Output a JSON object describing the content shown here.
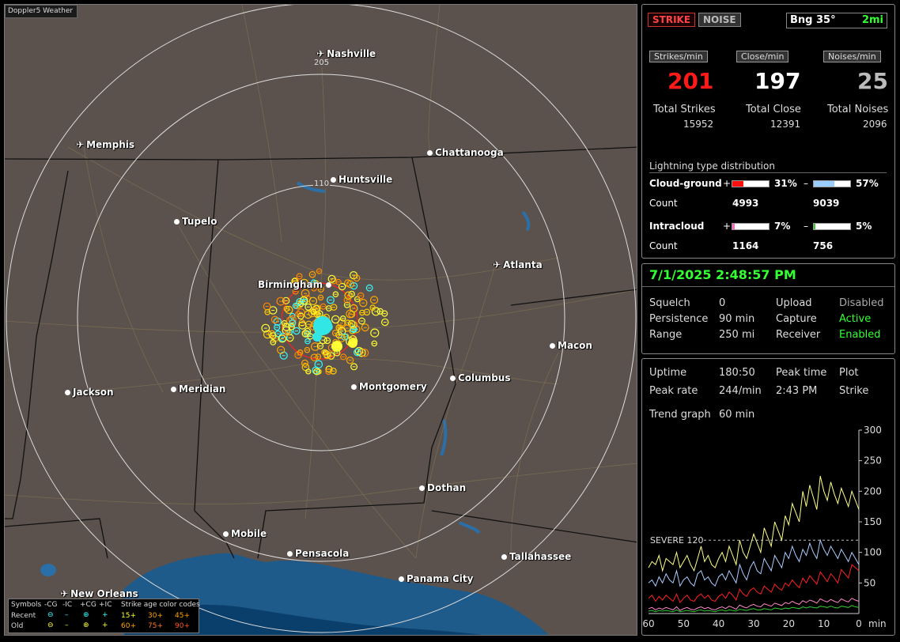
{
  "app_title": "Doppler5 Weather",
  "map": {
    "cities": [
      {
        "name": "Nashville",
        "icon": "airport-icon"
      },
      {
        "name": "Memphis",
        "icon": "airport-icon"
      },
      {
        "name": "Chattanooga",
        "icon": "city-dot-icon"
      },
      {
        "name": "Huntsville",
        "icon": "city-dot-icon"
      },
      {
        "name": "Tupelo",
        "icon": "city-dot-icon"
      },
      {
        "name": "Atlanta",
        "icon": "airport-icon"
      },
      {
        "name": "Birmingham",
        "icon": "city-dot-icon"
      },
      {
        "name": "Macon",
        "icon": "city-dot-icon"
      },
      {
        "name": "Jackson",
        "icon": "city-dot-icon"
      },
      {
        "name": "Meridian",
        "icon": "city-dot-icon"
      },
      {
        "name": "Montgomery",
        "icon": "city-dot-icon"
      },
      {
        "name": "Columbus",
        "icon": "city-dot-icon"
      },
      {
        "name": "Dothan",
        "icon": "city-dot-icon"
      },
      {
        "name": "Mobile",
        "icon": "city-dot-icon"
      },
      {
        "name": "Pensacola",
        "icon": "city-dot-icon"
      },
      {
        "name": "Tallahassee",
        "icon": "city-dot-icon"
      },
      {
        "name": "Panama City",
        "icon": "city-dot-icon"
      },
      {
        "name": "New Orleans",
        "icon": "airport-icon"
      }
    ],
    "range_labels": [
      "205",
      "110"
    ],
    "legend": {
      "symbols_label": "Symbols",
      "col_headers": [
        "-CG",
        "-IC",
        "+CG",
        "+IC"
      ],
      "age_header": "Strike age color codes",
      "recent_label": "Recent",
      "old_label": "Old",
      "recent_ages": [
        "15+",
        "30+",
        "45+"
      ],
      "old_ages": [
        "60+",
        "75+",
        "90+"
      ]
    }
  },
  "top_buttons": {
    "strike": "STRIKE",
    "noise": "NOISE",
    "bearing": "Bng 35°",
    "distance": "2mi"
  },
  "rates": {
    "strikes_header": "Strikes/min",
    "strikes_value": "201",
    "close_header": "Close/min",
    "close_value": "197",
    "noises_header": "Noises/min",
    "noises_value": "25"
  },
  "totals": {
    "strikes_label": "Total Strikes",
    "strikes_value": "15952",
    "close_label": "Total Close",
    "close_value": "12391",
    "noises_label": "Total Noises",
    "noises_value": "2096"
  },
  "distribution": {
    "title": "Lightning type distribution",
    "cg_label": "Cloud-ground",
    "count_label": "Count",
    "ic_label": "Intracloud",
    "plus": "+",
    "minus": "–",
    "cg_pos_pct": "31%",
    "cg_pos_fraction": 0.31,
    "cg_pos_count": "4993",
    "cg_neg_pct": "57%",
    "cg_neg_fraction": 0.57,
    "cg_neg_count": "9039",
    "ic_pos_pct": "7%",
    "ic_pos_fraction": 0.07,
    "ic_pos_count": "1164",
    "ic_neg_pct": "5%",
    "ic_neg_fraction": 0.05,
    "ic_neg_count": "756",
    "colors": {
      "cg_pos": "#ff1010",
      "cg_neg": "#99ccff",
      "ic_pos": "#ff66bb",
      "ic_neg": "#33cc33"
    }
  },
  "status": {
    "datetime": "7/1/2025 2:48:57 PM",
    "squelch_label": "Squelch",
    "squelch_value": "0",
    "persistence_label": "Persistence",
    "persistence_value": "90 min",
    "range_label": "Range",
    "range_value": "250 mi",
    "upload_label": "Upload",
    "upload_value": "Disabled",
    "capture_label": "Capture",
    "capture_value": "Active",
    "receiver_label": "Receiver",
    "receiver_value": "Enabled"
  },
  "stats": {
    "uptime_label": "Uptime",
    "uptime_value": "180:50",
    "peak_time_label": "Peak time",
    "peak_time_value": "2:43 PM",
    "plot_label": "Plot",
    "plot_value": "Strike",
    "peak_rate_label": "Peak rate",
    "peak_rate_value": "244/min",
    "trend_label": "Trend graph",
    "trend_value": "60 min"
  },
  "chart_data": {
    "type": "line",
    "xlabel": "min",
    "x_ticks": [
      "60",
      "50",
      "40",
      "30",
      "20",
      "10",
      "0"
    ],
    "xlim": [
      60,
      0
    ],
    "ylim": [
      0,
      300
    ],
    "y_ticks": [
      "300",
      "250",
      "200",
      "150",
      "100",
      "50"
    ],
    "threshold": {
      "label": "SEVERE 120",
      "value": 120
    },
    "series": [
      {
        "color": "#ffff88",
        "values": [
          75,
          85,
          80,
          95,
          70,
          90,
          85,
          80,
          100,
          75,
          85,
          95,
          80,
          70,
          90,
          110,
          85,
          95,
          80,
          75,
          90,
          100,
          85,
          110,
          95,
          80,
          120,
          100,
          90,
          110,
          130,
          115,
          100,
          140,
          125,
          110,
          150,
          135,
          120,
          160,
          145,
          180,
          165,
          150,
          200,
          175,
          210,
          190,
          170,
          225,
          200,
          185,
          215,
          195,
          180,
          205,
          190,
          175,
          200,
          185,
          170
        ]
      },
      {
        "color": "#aaccff",
        "values": [
          50,
          55,
          45,
          60,
          50,
          65,
          55,
          50,
          70,
          45,
          55,
          60,
          50,
          45,
          65,
          70,
          55,
          60,
          50,
          45,
          60,
          65,
          55,
          70,
          60,
          50,
          80,
          65,
          55,
          75,
          85,
          70,
          65,
          90,
          80,
          70,
          95,
          85,
          75,
          100,
          90,
          110,
          95,
          85,
          105,
          95,
          115,
          100,
          90,
          120,
          105,
          95,
          110,
          100,
          90,
          105,
          95,
          85,
          100,
          90,
          80
        ]
      },
      {
        "color": "#ff2020",
        "values": [
          25,
          30,
          20,
          28,
          22,
          30,
          25,
          20,
          32,
          18,
          25,
          30,
          22,
          20,
          28,
          32,
          25,
          30,
          22,
          20,
          28,
          32,
          25,
          35,
          30,
          22,
          40,
          32,
          28,
          38,
          42,
          35,
          32,
          45,
          40,
          35,
          48,
          42,
          38,
          50,
          45,
          55,
          48,
          42,
          58,
          50,
          62,
          55,
          48,
          68,
          60,
          52,
          65,
          58,
          50,
          72,
          65,
          58,
          80,
          75,
          70
        ]
      },
      {
        "color": "#ff88cc",
        "values": [
          8,
          10,
          6,
          9,
          7,
          10,
          8,
          6,
          11,
          5,
          8,
          10,
          7,
          6,
          9,
          11,
          8,
          10,
          7,
          6,
          9,
          11,
          8,
          12,
          10,
          7,
          14,
          11,
          9,
          13,
          15,
          12,
          11,
          16,
          14,
          12,
          17,
          15,
          13,
          18,
          16,
          20,
          17,
          15,
          21,
          18,
          22,
          20,
          17,
          24,
          21,
          19,
          23,
          20,
          18,
          24,
          21,
          19,
          25,
          22,
          20
        ]
      },
      {
        "color": "#33cc33",
        "values": [
          4,
          5,
          3,
          5,
          4,
          5,
          4,
          3,
          6,
          3,
          4,
          5,
          4,
          3,
          5,
          6,
          4,
          5,
          4,
          3,
          5,
          6,
          4,
          6,
          5,
          4,
          7,
          6,
          5,
          7,
          8,
          6,
          6,
          8,
          7,
          6,
          9,
          8,
          7,
          9,
          8,
          10,
          9,
          8,
          11,
          9,
          11,
          10,
          9,
          12,
          11,
          10,
          12,
          10,
          9,
          12,
          11,
          10,
          13,
          11,
          10
        ]
      }
    ]
  }
}
